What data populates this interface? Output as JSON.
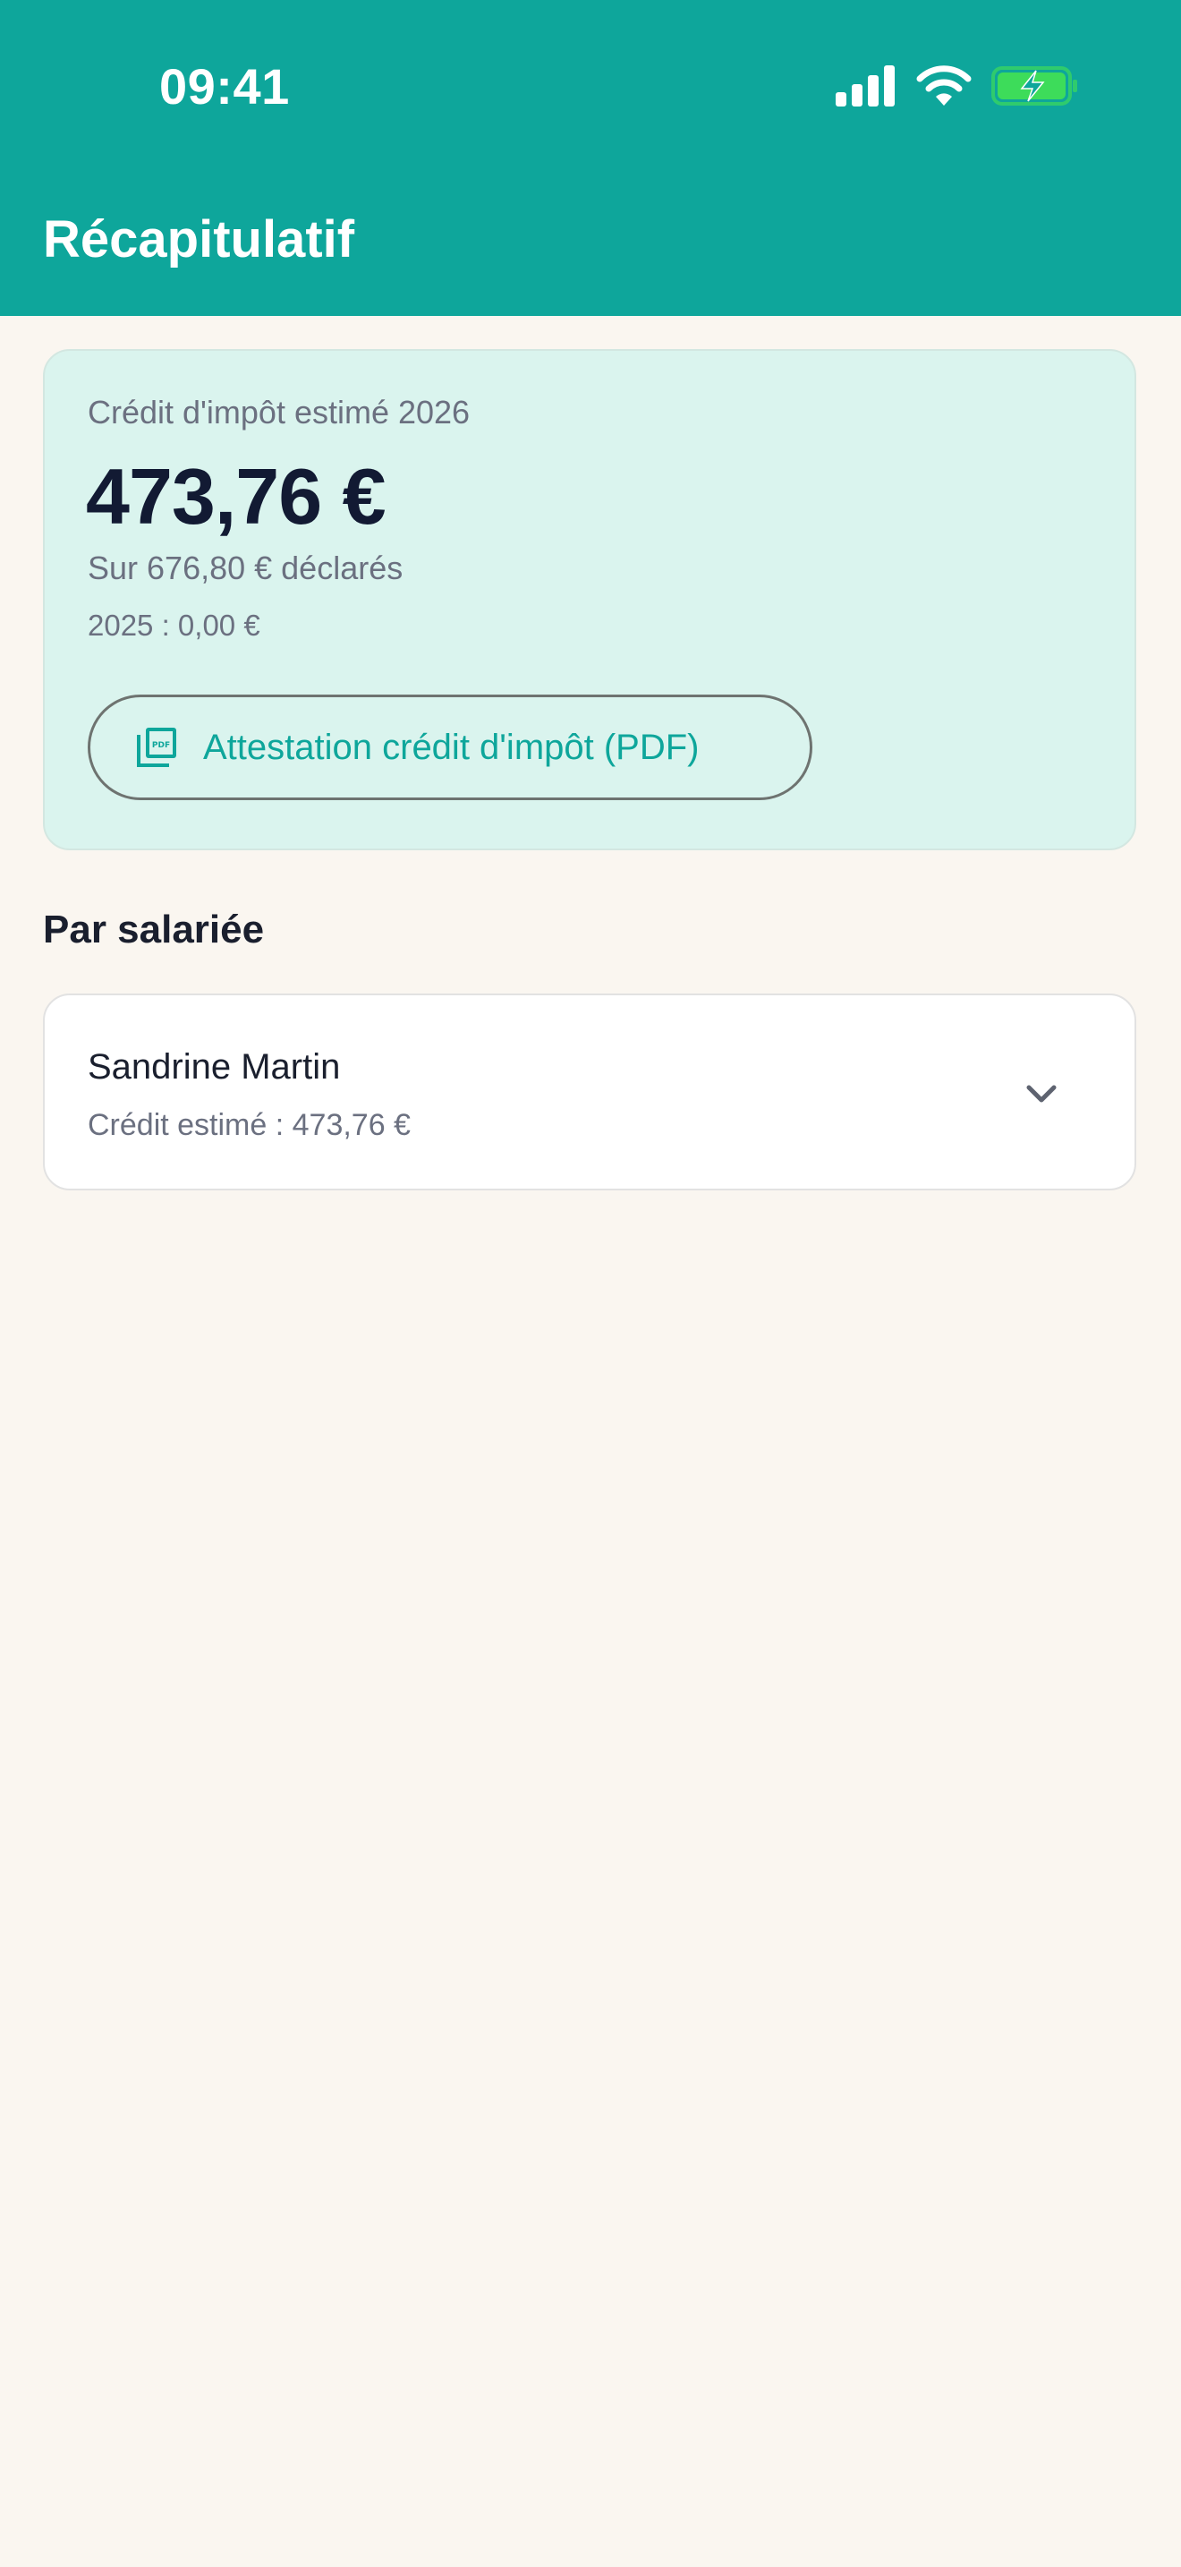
{
  "status_bar": {
    "time": "09:41",
    "icons": [
      "signal-icon",
      "wifi-icon",
      "battery-charging-icon"
    ]
  },
  "header": {
    "title": "Récapitulatif"
  },
  "credit_summary": {
    "label": "Crédit d'impôt estimé 2026",
    "amount": "473,76 €",
    "declared": "Sur 676,80 € déclarés",
    "previous_year": "2025 : 0,00 €",
    "pdf_button_label": "Attestation crédit d'impôt (PDF)",
    "pdf_icon": "pdf-document-icon"
  },
  "employees_section": {
    "title": "Par salariée",
    "items": [
      {
        "name": "Sandrine Martin",
        "credit": "Crédit estimé : 473,76 €",
        "icon": "chevron-down-icon"
      }
    ]
  },
  "colors": {
    "primary": "#0EA69B",
    "background": "#FAF6F0",
    "card_highlight": "#DAF4EE",
    "text_dark": "#121A33",
    "text_muted": "#6B7080",
    "battery_fill": "#3DDC5A"
  }
}
